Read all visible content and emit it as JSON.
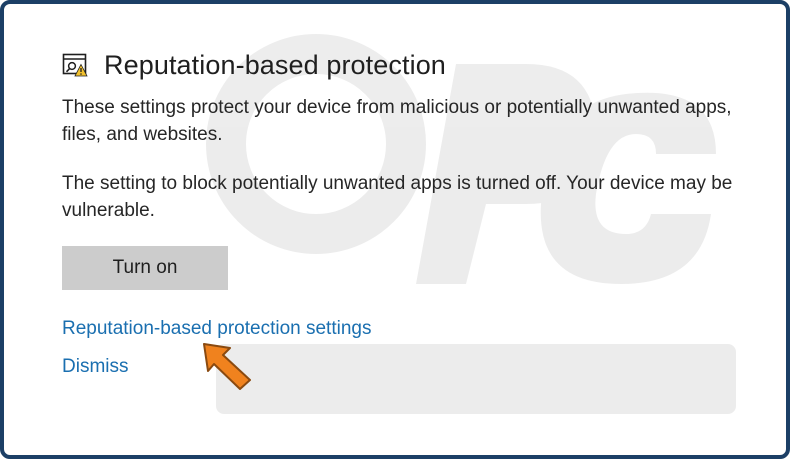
{
  "panel": {
    "icon": "browser-shield-icon",
    "title": "Reputation-based protection",
    "description": "These settings protect your device from malicious or potentially unwanted apps, files, and websites.",
    "warning": "The setting to block potentially unwanted apps is turned off. Your device may be vulnerable.",
    "turn_on_label": "Turn on",
    "settings_link": "Reputation-based protection settings",
    "dismiss_link": "Dismiss"
  },
  "colors": {
    "border": "#1c3f66",
    "link": "#1a6fb0",
    "button_bg": "#cccccc",
    "arrow": "#f0821e",
    "warning_badge": "#f2c12e"
  },
  "overlay": {
    "arrow_icon": "orange-pointer-arrow-icon"
  }
}
